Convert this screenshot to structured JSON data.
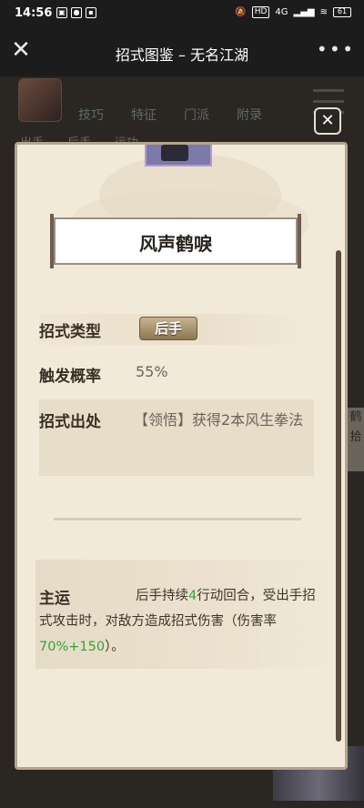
{
  "status_bar": {
    "time": "14:56",
    "network": "4G",
    "hd": "HD",
    "battery": "61"
  },
  "nav": {
    "title": "招式图鉴 – 无名江湖",
    "close_icon": "close-icon",
    "more_icon": "more-dots-icon"
  },
  "background": {
    "tabs_row1": [
      "技巧",
      "特征",
      "门派",
      "附录"
    ],
    "tabs_row2": [
      "出手",
      "后手",
      "运功"
    ],
    "side_text": "鹤\n拾"
  },
  "popup": {
    "skill_name": "风声鹤唳",
    "type_label": "招式类型",
    "type_value": "后手",
    "rate_label": "触发概率",
    "rate_value": "55%",
    "source_label": "招式出处",
    "source_value": "【领悟】获得2本风生拳法",
    "effect_label": "主运",
    "effect_parts": {
      "p1": "后手持续",
      "n1": "4",
      "p2": "行动回合，受出手招式攻击时，对敌方造成招式伤害（伤害率",
      "n2": "70%+150",
      "p3": "）。"
    }
  },
  "colors": {
    "card_bg": "#f2ead9",
    "badge": "#8c7753",
    "highlight": "#3aa13a"
  }
}
